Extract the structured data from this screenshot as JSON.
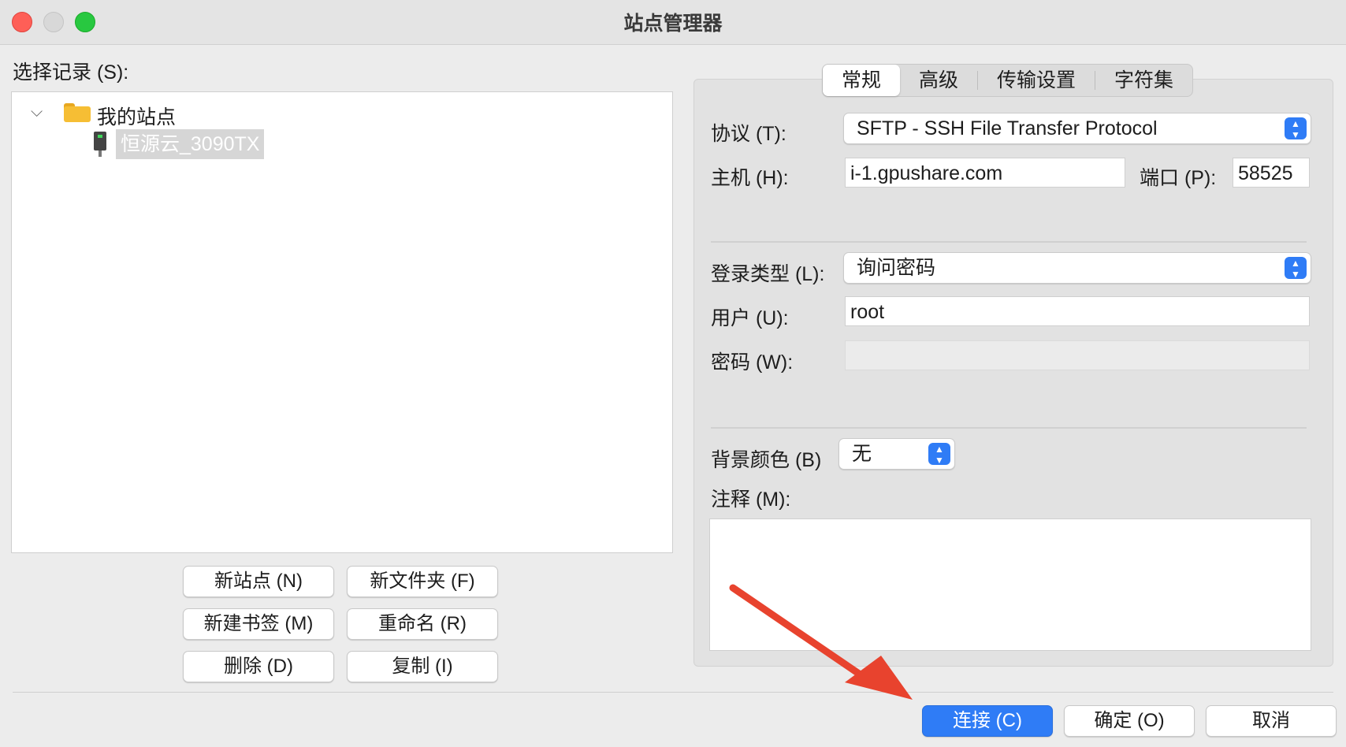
{
  "window": {
    "title": "站点管理器"
  },
  "left": {
    "select_label": "选择记录 (S):",
    "tree": {
      "root": "我的站点",
      "site": "恒源云_3090TX"
    },
    "buttons": {
      "new_site": "新站点 (N)",
      "new_folder": "新文件夹 (F)",
      "new_bookmark": "新建书签 (M)",
      "rename": "重命名 (R)",
      "delete": "删除 (D)",
      "copy": "复制 (I)"
    }
  },
  "tabs": [
    "常规",
    "高级",
    "传输设置",
    "字符集"
  ],
  "form": {
    "protocol_label": "协议 (T):",
    "protocol_value": "SFTP - SSH File Transfer Protocol",
    "host_label": "主机 (H):",
    "host_value": "i-1.gpushare.com",
    "port_label": "端口 (P):",
    "port_value": "58525",
    "logon_label": "登录类型 (L):",
    "logon_value": "询问密码",
    "user_label": "用户 (U):",
    "user_value": "root",
    "password_label": "密码 (W):",
    "bgcolor_label": "背景颜色 (B)",
    "bgcolor_value": "无",
    "comment_label": "注释 (M):"
  },
  "footer": {
    "connect": "连接 (C)",
    "ok": "确定 (O)",
    "cancel": "取消"
  },
  "colors": {
    "accent": "#2f7cf6",
    "annotation_arrow": "#e8432e"
  }
}
